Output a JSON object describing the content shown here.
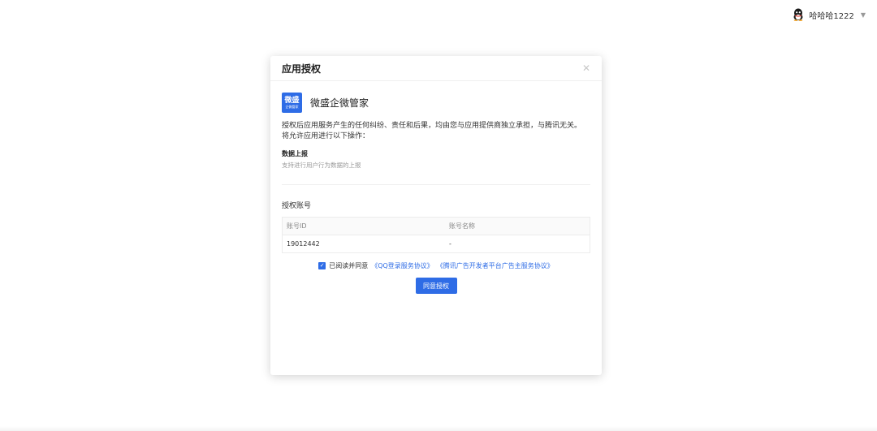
{
  "user": {
    "name": "哈哈哈1222",
    "avatar_icon": "qq-penguin-icon",
    "dropdown_icon": "chevron-down-icon"
  },
  "modal": {
    "title": "应用授权",
    "close_icon": "close-icon",
    "app": {
      "logo_text_main": "微盛",
      "logo_text_sub": "企微管家",
      "name": "微盛企微管家"
    },
    "description_line1": "授权后应用服务产生的任何纠纷、责任和后果，均由您与应用提供商独立承担，与腾讯无关。",
    "description_line2": "将允许应用进行以下操作：",
    "permission": {
      "title": "数据上报",
      "desc": "支持进行用户行为数据的上报"
    },
    "account_section_title": "授权账号",
    "table": {
      "headers": [
        "账号ID",
        "账号名称"
      ],
      "rows": [
        [
          "19012442",
          "-"
        ]
      ]
    },
    "agreement": {
      "prefix": "已阅读并同意",
      "link1": "《QQ登录服务协议》",
      "link2": "《腾讯广告开发者平台广告主服务协议》",
      "checked": true
    },
    "confirm_label": "同意授权"
  },
  "colors": {
    "accent": "#2e6ce6"
  }
}
